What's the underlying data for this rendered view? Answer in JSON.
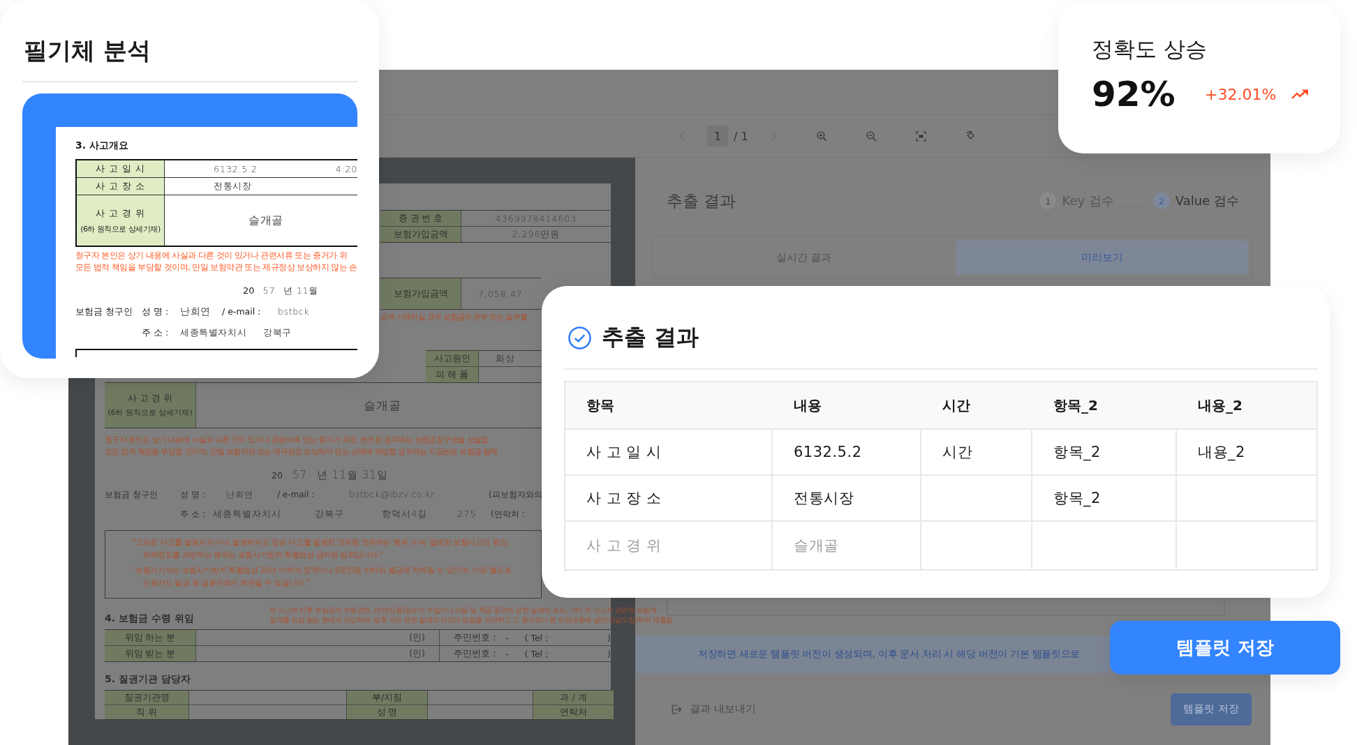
{
  "handwriting_card": {
    "title": "필기체 분석",
    "document": {
      "section": "3. 사고개요",
      "rows": [
        {
          "label": "사 고 일 시",
          "value": "6132.5.2",
          "extra": "4:20"
        },
        {
          "label": "사 고 장 소",
          "value": "전통시장"
        },
        {
          "label": "사 고 경 위",
          "sublabel": "(6하 원칙으로 상세기재)",
          "value": "슬개골"
        }
      ],
      "notice": [
        "청구자 본인은 상기 내용에 사실과 다른 것이 있거나 관련서류 또는 증거가 위",
        "모든 법적 책임을 부담할 것이며, 만일 보험약관 또는 제규정상 보상하지 않는 손"
      ],
      "date": {
        "prefix": "20",
        "year": "57",
        "rest": "년 11월"
      },
      "claimant": {
        "label": "보험금 청구인",
        "name_label": "성 명 :",
        "name": "난희연",
        "email_label": "/ e-mail :",
        "email": "bstbck",
        "address_label": "주 소 :",
        "address": [
          "세종특별자치시",
          "강북구"
        ]
      }
    }
  },
  "viewer": {
    "toolbar": {
      "page": "1",
      "total": "/ 1"
    },
    "document": {
      "top_rows": [
        {
          "label": "증 권 번 호",
          "value": "4369978414603"
        },
        {
          "label": "보험가입금액",
          "value": "2,296만원"
        }
      ],
      "amount_row": {
        "label": "보험가입금액",
        "value": "7,058,47"
      },
      "notice_fragment": "르게 기재하실 경우 보험금의 전부 또는 일부를",
      "cause_rows": [
        {
          "label": "사고원인",
          "value": "화상"
        },
        {
          "label": "피 해 품"
        }
      ],
      "details_row": {
        "label": "사 고 경 위",
        "sublabel": "(6하 원칙으로 상세기재)",
        "value": "슬개골"
      },
      "notice": [
        "청구자 본인은 상기 내용에 사실과 다른 것이 있거나 관련서류 또는 증거가 위조, 변조된 경우에는 보험금청구권을 상실할",
        "모든 법적 책임을 부담할 것이며, 만일 보험약관 또는 제규정상 보상하지 않는 손해에 해당할 경우에는 지급받은 보험금 일체"
      ],
      "date": {
        "prefix": "20",
        "year": "57",
        "rest": "년 11월 31일"
      },
      "claimant": {
        "label": "보험금 청구인",
        "name_label": "성 명 :",
        "name": "난희연",
        "email_label": "/ e-mail :",
        "email": "bstbck@ibzv.co.kr",
        "relation": "(피보험자와의",
        "address_label": "주 소 :",
        "address": [
          "세종특별자치시",
          "강북구",
          "항덕서4길",
          "275"
        ],
        "contact": "(연락처 :"
      },
      "warnings": [
        [
          "“고의로 사고를 발생시키거나, 발생하지도 않은 사고를 발생한 것처럼 조작하는 행위, 이미 발생한 보험사고의 원인,",
          "피해정도를 과장하는 행위는 보험사기방지 특별법상 금지된 범죄입니다.”"
        ],
        [
          "“보험사기자는 보험사기방지 특별법상 10년 이하의 징역이나 5천만원 이하의 벌금에 처해질 수 있으며, 이와 별도로",
          "신용카드 발급 등 금융거래가 제한될 수 있습니다.”"
        ]
      ],
      "delegation": {
        "title": "4. 보험금 수령 위임",
        "note": [
          "위 사고에 따른 보험금의 수령권한, 개인(신용)정보의 수집이나 이용 및 제공 동의에 관한 일체의 권리, 기타 위 사고와 관련된 보험계",
          "일체를 위임 받는 분에게 위임하며, 향후 이와 관련 일체의 이의가 없음을 서약하고 그 증거로서 본 위임내용에 날인(인감도장)하여 제출합"
        ],
        "rows": [
          {
            "label": "위임 하는 분",
            "seal": "(인)",
            "id_label": "주민번호 :",
            "dash": "-",
            "tel": "( Tel :",
            "close": ")"
          },
          {
            "label": "위임 받는 분",
            "seal": "(인)",
            "id_label": "주민번호 :",
            "dash": "-",
            "tel": "( Tel :",
            "close": ")"
          }
        ]
      },
      "agency": {
        "title": "5. 질권기관 담당자",
        "rows": [
          [
            "질권기관명",
            "부/지점",
            "과 / 계"
          ],
          [
            "직 위",
            "성 명",
            "연락처"
          ]
        ]
      }
    },
    "panel": {
      "title": "추출 결과",
      "steps": [
        {
          "number": "1",
          "label": "Key 검수",
          "selected": false
        },
        {
          "number": "2",
          "label": "Value 검수",
          "selected": true
        }
      ],
      "tabs": [
        {
          "label": "실시간 결과",
          "selected": false
        },
        {
          "label": "미리보기",
          "selected": true
        }
      ],
      "notice": "저장하면 새로운 템플릿 버전이 생성되며, 이후 문서 처리 시 해당 버전이 기본 템플릿으로",
      "export": "결과 내보내기",
      "save": "템플릿 저장"
    }
  },
  "accuracy_card": {
    "title": "정확도 상승",
    "value": "92%",
    "change": "+32.01%"
  },
  "results_card": {
    "title": "추출 결과",
    "columns": [
      "항목",
      "내용",
      "시간",
      "항목_2",
      "내용_2"
    ],
    "rows": [
      {
        "muted": false,
        "cells": [
          "사 고 일 시",
          "6132.5.2",
          "시간",
          "항목_2",
          "내용_2"
        ]
      },
      {
        "muted": false,
        "cells": [
          "사 고 장 소",
          "전통시장",
          null,
          "항목_2",
          null
        ]
      },
      {
        "muted": true,
        "cells": [
          "사 고 경 위",
          "슬개골",
          null,
          null,
          null
        ]
      }
    ]
  },
  "save_button": {
    "label": "템플릿 저장"
  }
}
